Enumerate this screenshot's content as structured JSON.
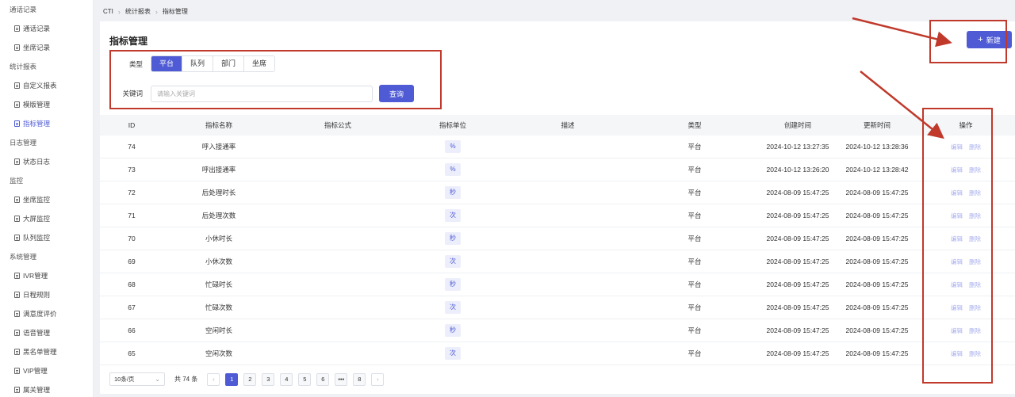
{
  "sidebar": {
    "sections": [
      {
        "group": "通话记录",
        "items": [
          {
            "label": "通话记录"
          },
          {
            "label": "坐席记录"
          }
        ]
      },
      {
        "group": "统计报表",
        "items": [
          {
            "label": "自定义报表"
          },
          {
            "label": "模版管理"
          },
          {
            "label": "指标管理",
            "active": true
          }
        ]
      },
      {
        "group": "日志管理",
        "items": [
          {
            "label": "状态日志"
          }
        ]
      },
      {
        "group": "监控",
        "items": [
          {
            "label": "坐席监控"
          },
          {
            "label": "大屏监控"
          },
          {
            "label": "队列监控"
          }
        ]
      },
      {
        "group": "系统管理",
        "items": [
          {
            "label": "IVR管理"
          },
          {
            "label": "日程规则"
          },
          {
            "label": "满意度评价"
          },
          {
            "label": "语音管理"
          },
          {
            "label": "黑名单管理"
          },
          {
            "label": "VIP管理"
          },
          {
            "label": "属关管理"
          }
        ]
      }
    ]
  },
  "breadcrumb": [
    "CTI",
    "统计报表",
    "指标管理"
  ],
  "page_title": "指标管理",
  "new_button": "新建",
  "filter": {
    "type_label": "类型",
    "types": [
      "平台",
      "队列",
      "部门",
      "坐席"
    ],
    "active_type": "平台",
    "keyword_label": "关键词",
    "keyword_placeholder": "请输入关键词",
    "keyword_value": "",
    "search_label": "查询"
  },
  "table": {
    "headers": {
      "id": "ID",
      "name": "指标名称",
      "formula": "指标公式",
      "unit": "指标单位",
      "desc": "描述",
      "type": "类型",
      "created": "创建时间",
      "updated": "更新时间",
      "ops": "操作"
    },
    "rows": [
      {
        "id": "74",
        "name": "呼入接通率",
        "formula": "",
        "unit": "%",
        "desc": "",
        "type": "平台",
        "created": "2024-10-12 13:27:35",
        "updated": "2024-10-12 13:28:36"
      },
      {
        "id": "73",
        "name": "呼出接通率",
        "formula": "",
        "unit": "%",
        "desc": "",
        "type": "平台",
        "created": "2024-10-12 13:26:20",
        "updated": "2024-10-12 13:28:42"
      },
      {
        "id": "72",
        "name": "后处理时长",
        "formula": "",
        "unit": "秒",
        "desc": "",
        "type": "平台",
        "created": "2024-08-09 15:47:25",
        "updated": "2024-08-09 15:47:25"
      },
      {
        "id": "71",
        "name": "后处理次数",
        "formula": "",
        "unit": "次",
        "desc": "",
        "type": "平台",
        "created": "2024-08-09 15:47:25",
        "updated": "2024-08-09 15:47:25"
      },
      {
        "id": "70",
        "name": "小休时长",
        "formula": "",
        "unit": "秒",
        "desc": "",
        "type": "平台",
        "created": "2024-08-09 15:47:25",
        "updated": "2024-08-09 15:47:25"
      },
      {
        "id": "69",
        "name": "小休次数",
        "formula": "",
        "unit": "次",
        "desc": "",
        "type": "平台",
        "created": "2024-08-09 15:47:25",
        "updated": "2024-08-09 15:47:25"
      },
      {
        "id": "68",
        "name": "忙碌时长",
        "formula": "",
        "unit": "秒",
        "desc": "",
        "type": "平台",
        "created": "2024-08-09 15:47:25",
        "updated": "2024-08-09 15:47:25"
      },
      {
        "id": "67",
        "name": "忙碌次数",
        "formula": "",
        "unit": "次",
        "desc": "",
        "type": "平台",
        "created": "2024-08-09 15:47:25",
        "updated": "2024-08-09 15:47:25"
      },
      {
        "id": "66",
        "name": "空闲时长",
        "formula": "",
        "unit": "秒",
        "desc": "",
        "type": "平台",
        "created": "2024-08-09 15:47:25",
        "updated": "2024-08-09 15:47:25"
      },
      {
        "id": "65",
        "name": "空闲次数",
        "formula": "",
        "unit": "次",
        "desc": "",
        "type": "平台",
        "created": "2024-08-09 15:47:25",
        "updated": "2024-08-09 15:47:25"
      }
    ],
    "edit_label": "编辑",
    "delete_label": "删除"
  },
  "pagination": {
    "page_size": "10条/页",
    "total": "共 74 条",
    "pages": [
      "1",
      "2",
      "3",
      "4",
      "5",
      "6",
      "•••",
      "8"
    ],
    "current": "1"
  },
  "colors": {
    "accent": "#4f5bd5",
    "annotation": "#c0392b"
  }
}
